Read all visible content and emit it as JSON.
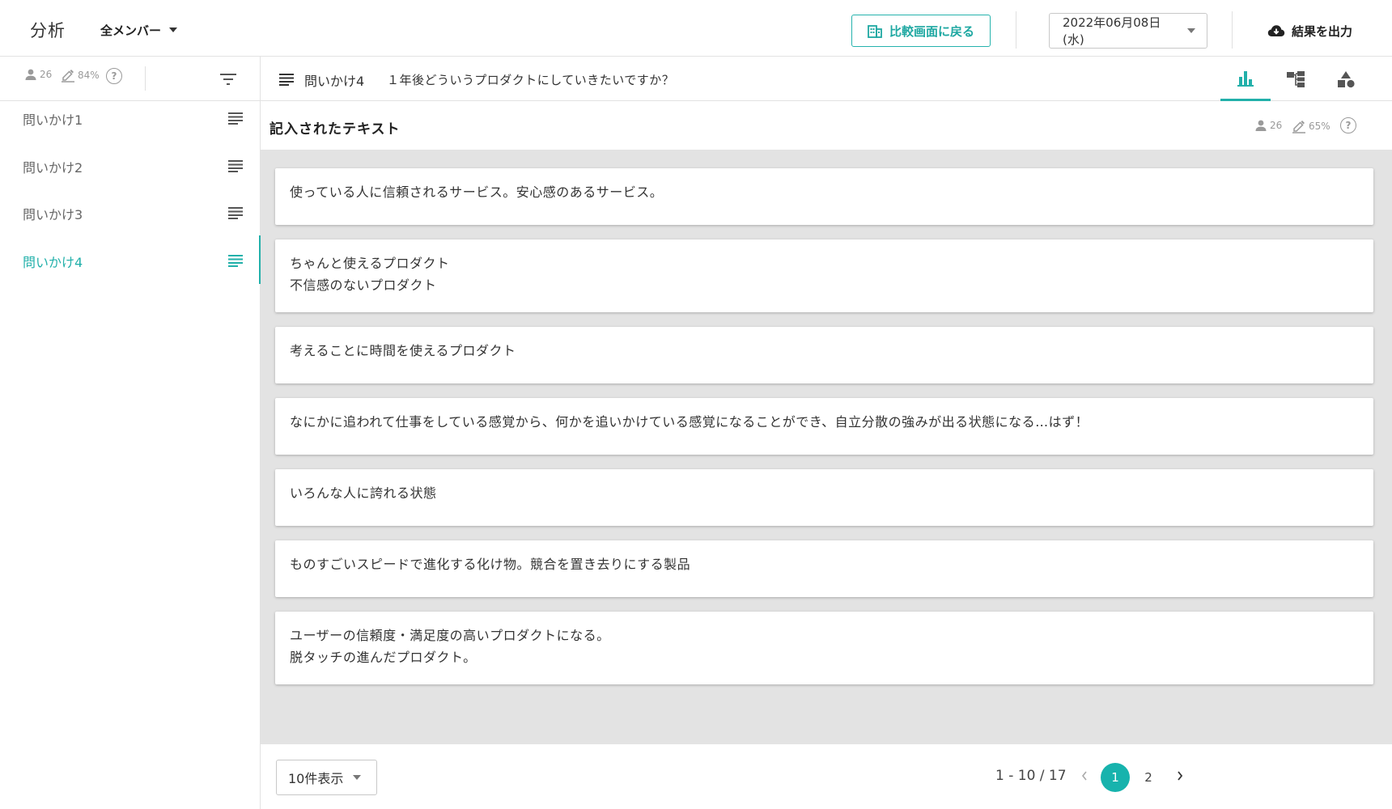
{
  "header": {
    "title": "分析",
    "member_filter": "全メンバー",
    "back_button_label": "比較画面に戻る",
    "date": "2022年06月08日(水)",
    "export_label": "結果を出力"
  },
  "sidebar": {
    "respondents": "26",
    "response_rate": "84%",
    "help": "?",
    "items": [
      {
        "label": "問いかけ1"
      },
      {
        "label": "問いかけ2"
      },
      {
        "label": "問いかけ3"
      },
      {
        "label": "問いかけ4"
      }
    ],
    "active_index": 3
  },
  "question": {
    "title": "問いかけ4",
    "text": "１年後どういうプロダクトにしていきたいですか？"
  },
  "view_tabs": [
    {
      "icon": "bar-chart-icon",
      "active": true
    },
    {
      "icon": "tree-diagram-icon",
      "active": false
    },
    {
      "icon": "shapes-icon",
      "active": false
    }
  ],
  "section": {
    "title": "記入されたテキスト",
    "respondents": "26",
    "response_rate": "65%",
    "help": "?"
  },
  "answers": [
    {
      "lines": [
        "使っている人に信頼されるサービス。安心感のあるサービス。"
      ]
    },
    {
      "lines": [
        "ちゃんと使えるプロダクト",
        "不信感のないプロダクト"
      ]
    },
    {
      "lines": [
        "考えることに時間を使えるプロダクト"
      ]
    },
    {
      "lines": [
        "なにかに追われて仕事をしている感覚から、何かを追いかけている感覚になることができ、自立分散の強みが出る状態になる…はず！"
      ]
    },
    {
      "lines": [
        "いろんな人に誇れる状態"
      ]
    },
    {
      "lines": [
        "ものすごいスピードで進化する化け物。競合を置き去りにする製品"
      ]
    },
    {
      "lines": [
        "ユーザーの信頼度・満足度の高いプロダクトになる。",
        "脱タッチの進んだプロダクト。"
      ]
    }
  ],
  "footer": {
    "per_page": "10件表示",
    "range": "1 - 10 / 17",
    "pages": [
      "1",
      "2"
    ],
    "current_page": "1"
  },
  "colors": {
    "accent": "#22b0aa",
    "background": "#e3e3e3",
    "muted_text": "#9a9a9a"
  }
}
